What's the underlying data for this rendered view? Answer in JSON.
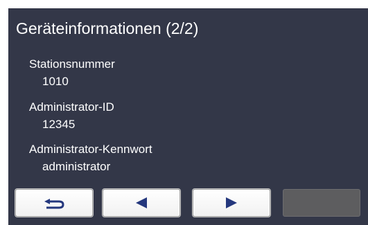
{
  "title": "Geräteinformationen (2/2)",
  "fields": [
    {
      "label": "Stationsnummer",
      "value": "1010"
    },
    {
      "label": "Administrator-ID",
      "value": "12345"
    },
    {
      "label": "Administrator-Kennwort",
      "value": "administrator"
    }
  ],
  "buttons": [
    {
      "name": "back",
      "icon": "return-arrow-icon",
      "enabled": true
    },
    {
      "name": "previous",
      "icon": "triangle-left-icon",
      "enabled": true
    },
    {
      "name": "next",
      "icon": "triangle-right-icon",
      "enabled": true
    },
    {
      "name": "blank",
      "icon": "",
      "enabled": false
    }
  ],
  "colors": {
    "screen_background": "#333748",
    "text": "#ffffff",
    "icon": "#24377d",
    "button_face": "#ffffff",
    "button_disabled": "#5d5d5f"
  }
}
